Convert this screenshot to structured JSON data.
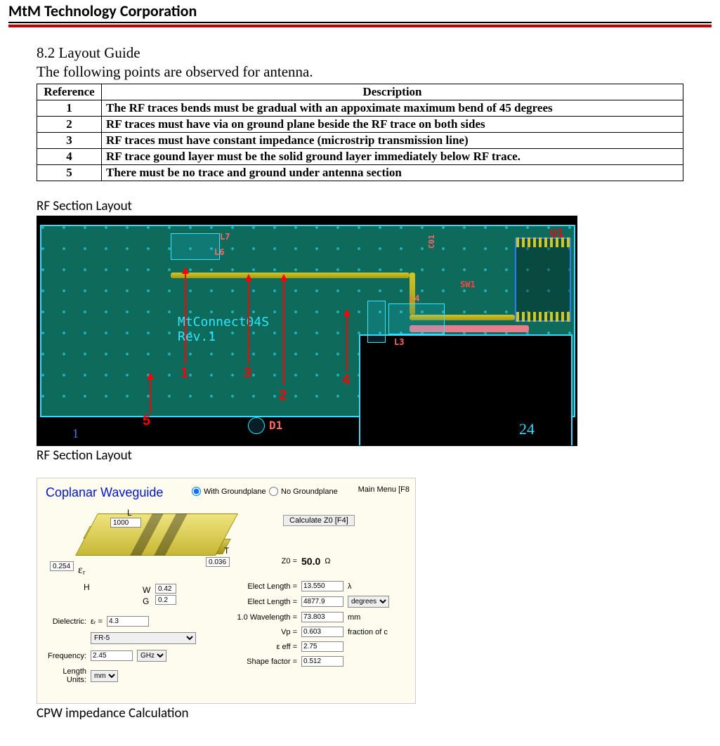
{
  "header": {
    "company": "MtM Technology Corporation"
  },
  "section": {
    "number": "8.2 Layout Guide",
    "intro": "The following points are observed for antenna."
  },
  "ref_table": {
    "headers": [
      "Reference",
      "Description"
    ],
    "rows": [
      {
        "ref": "1",
        "desc": "The RF traces bends must be gradual with an appoximate maximum bend of 45 degrees"
      },
      {
        "ref": "2",
        "desc": "RF traces must have via on ground plane beside the RF trace on both sides"
      },
      {
        "ref": "3",
        "desc": "RF traces must have constant impedance (microstrip transmission line)"
      },
      {
        "ref": "4",
        "desc": "RF trace gound layer must be the solid ground layer immediately below RF trace."
      },
      {
        "ref": "5",
        "desc": "There must be no trace and ground under antenna section"
      }
    ]
  },
  "captions": {
    "rf1": "RF Section Layout",
    "rf2": "RF Section Layout",
    "cpw": "CPW impedance Calculation"
  },
  "pcb": {
    "board_label_line1": "MtConnect04S",
    "board_label_line2": "Rev.1",
    "refs": {
      "u1": "U1",
      "sw1": "SW1",
      "d1": "D1",
      "l7": "L7",
      "l6": "L6",
      "l4": "L4",
      "l3": "L3",
      "c01": "C01"
    },
    "corner_24": "24",
    "corner_1": "1",
    "arrow_labels": {
      "n1": "1",
      "n2": "2",
      "n3": "3",
      "n4": "4",
      "n5": "5"
    }
  },
  "cpw": {
    "title": "Coplanar Waveguide",
    "mainmenu": "Main Menu [F8",
    "radio_with": "With Groundplane",
    "radio_no": "No Groundplane",
    "calc_btn": "Calculate Z0 [F4]",
    "dims": {
      "L_label": "L",
      "L_val": "1000",
      "T_label": "T",
      "T_val": "0.036",
      "H_label": "H",
      "H_val": "0.254",
      "W_label": "W",
      "W_val": "0.42",
      "G_label": "G",
      "G_val": "0.2",
      "epsr": "εᵣ"
    },
    "left": {
      "dielectric_label": "Dielectric:",
      "epsr_label": "εᵣ =",
      "epsr_val": "4.3",
      "material_val": "FR-5",
      "freq_label": "Frequency:",
      "freq_val": "2.45",
      "freq_unit": "GHz",
      "len_label": "Length Units:",
      "len_unit": "mm"
    },
    "right": {
      "z0_label": "Z0 =",
      "z0_val": "50.0",
      "z0_unit": "Ω",
      "elec_len_lambda_label": "Elect Length =",
      "elec_len_lambda_val": "13.550",
      "elec_len_lambda_unit": "λ",
      "elec_len_deg_label": "Elect Length =",
      "elec_len_deg_val": "4877.9",
      "elec_len_deg_unit": "degrees",
      "wavelength_label": "1.0 Wavelength =",
      "wavelength_val": "73.803",
      "wavelength_unit": "mm",
      "vp_label": "Vp =",
      "vp_val": "0.603",
      "vp_unit": "fraction of c",
      "eeff_label": "ε eff =",
      "eeff_val": "2.75",
      "shape_label": "Shape factor =",
      "shape_val": "0.512"
    }
  }
}
